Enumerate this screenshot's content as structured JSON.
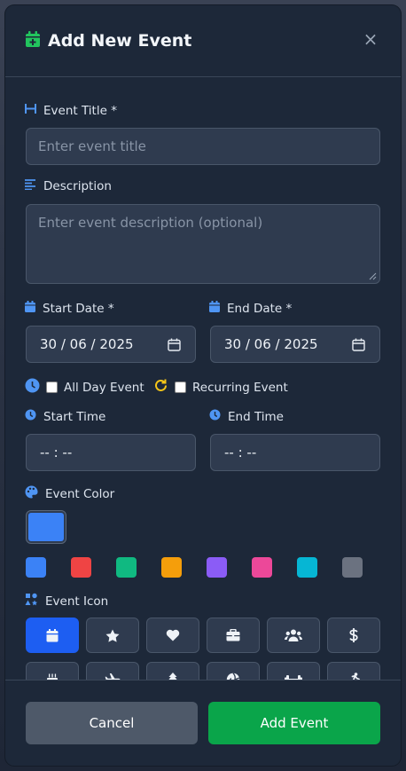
{
  "header": {
    "title": "Add New Event",
    "close_label": "×"
  },
  "fields": {
    "title": {
      "label": "Event Title *",
      "placeholder": "Enter event title"
    },
    "description": {
      "label": "Description",
      "placeholder": "Enter event description (optional)"
    },
    "start_date": {
      "label": "Start Date *",
      "value": "30 / 06 / 2025"
    },
    "end_date": {
      "label": "End Date *",
      "value": "30 / 06 / 2025"
    },
    "all_day": {
      "label": "All Day Event"
    },
    "recurring": {
      "label": "Recurring Event"
    },
    "start_time": {
      "label": "Start Time",
      "value": "-- : --"
    },
    "end_time": {
      "label": "End Time",
      "value": "-- : --"
    },
    "color": {
      "label": "Event Color",
      "selected": "#3b82f6",
      "palette": [
        "#3b82f6",
        "#ef4444",
        "#10b981",
        "#f59e0b",
        "#8b5cf6",
        "#ec4899",
        "#06b6d4",
        "#6b7280"
      ]
    },
    "icon": {
      "label": "Event Icon",
      "icons": [
        "calendar-icon",
        "star-icon",
        "heart-icon",
        "briefcase-icon",
        "users-icon",
        "dollar-icon",
        "birthday-cake-icon",
        "plane-icon",
        "tree-icon",
        "volleyball-icon",
        "dumbbell-icon",
        "running-icon"
      ]
    }
  },
  "footer": {
    "cancel_label": "Cancel",
    "submit_label": "Add Event"
  },
  "colors": {
    "accent": "#1d5ef2",
    "success": "#0aa54a",
    "green_icon": "#22c55e",
    "blue_icon": "#4f95f3",
    "yellow_icon": "#f5c518"
  }
}
